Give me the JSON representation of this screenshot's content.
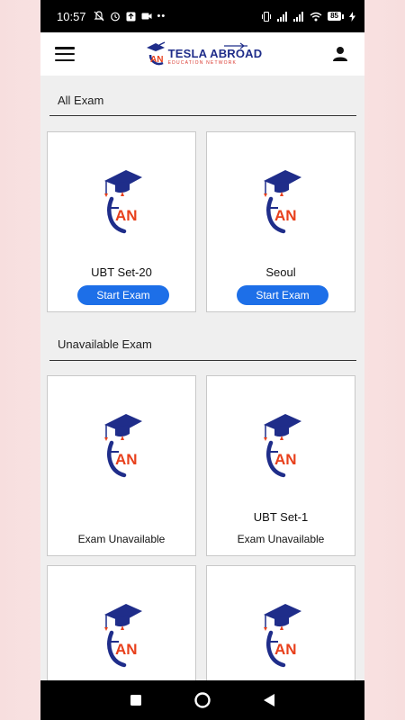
{
  "status_bar": {
    "time": "10:57",
    "battery": "85",
    "left_icons": [
      "notification-off-icon",
      "alarm-icon",
      "upload-icon",
      "video-icon",
      "more-dots-icon"
    ],
    "right_icons": [
      "vibrate-icon",
      "signal-icon",
      "signal-icon",
      "wifi-icon",
      "battery-icon",
      "charging-icon"
    ]
  },
  "header": {
    "logo_title": "TESLA ABROAD",
    "logo_subtitle": "EDUCATION NETWORK",
    "logo_mark": "AN",
    "menu_icon": "hamburger-menu-icon",
    "profile_icon": "person-icon"
  },
  "sections": {
    "all_exam_title": "All Exam",
    "unavailable_title": "Unavailable Exam"
  },
  "all_exams": [
    {
      "name": "UBT Set-20",
      "button": "Start Exam"
    },
    {
      "name": "Seoul",
      "button": "Start Exam"
    }
  ],
  "unavailable_exams": [
    {
      "name": "",
      "status": "Exam Unavailable"
    },
    {
      "name": "UBT Set-1",
      "status": "Exam Unavailable"
    },
    {
      "name": "",
      "status": ""
    },
    {
      "name": "",
      "status": ""
    }
  ],
  "emblem_text": "AN",
  "colors": {
    "brand_blue": "#1f2d8a",
    "brand_red": "#e8401c",
    "button_blue": "#1d6fe8"
  },
  "nav_bar": {
    "icons": [
      "recent-apps-icon",
      "home-icon",
      "back-icon"
    ]
  }
}
